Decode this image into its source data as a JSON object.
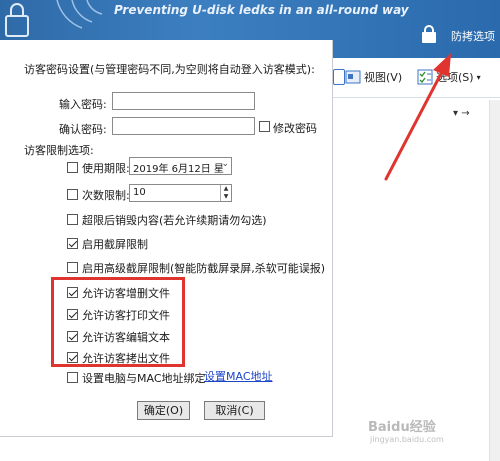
{
  "banner": {
    "slogan": "Preventing U-disk ledks in an all-round way",
    "anti_copy_label": "防拷选项"
  },
  "app_toolbar": {
    "items": [
      {
        "label": "视图(V)",
        "icon": "view-icon"
      },
      {
        "label": "选项(S)",
        "icon": "options-icon"
      }
    ],
    "nav_glyph": "▾  →"
  },
  "dialog": {
    "section_title": "访客密码设置(与管理密码不同,为空则将自动登入访客模式):",
    "password_label": "输入密码:",
    "confirm_label": "确认密码:",
    "change_password_label": "修改密码",
    "restriction_title": "访客限制选项:",
    "options": [
      {
        "label": "使用期限:",
        "checked": false
      },
      {
        "label": "次数限制:",
        "checked": false
      },
      {
        "label": "超限后销毁内容(若允许续期请勿勾选)",
        "checked": false
      },
      {
        "label": "启用截屏限制",
        "checked": true
      },
      {
        "label": "启用高级截屏限制(智能防截屏录屏,杀软可能误报)",
        "checked": false
      },
      {
        "label": "允许访客增删文件",
        "checked": true
      },
      {
        "label": "允许访客打印文件",
        "checked": true
      },
      {
        "label": "允许访客编辑文本",
        "checked": true
      },
      {
        "label": "允许访客拷出文件",
        "checked": true
      },
      {
        "label": "设置电脑与MAC地址绑定",
        "checked": false
      }
    ],
    "date_value": "2019年 6月12日 星",
    "count_value": "10",
    "mac_link": "设置MAC地址",
    "ok_button": "确定(O)",
    "cancel_button": "取消(C)"
  },
  "watermark": {
    "main": "Baidu经验",
    "sub": "jingyan.baidu.com"
  },
  "colors": {
    "banner": "#2f6aa8",
    "highlight": "#e0352f",
    "link": "#1a45c8"
  }
}
